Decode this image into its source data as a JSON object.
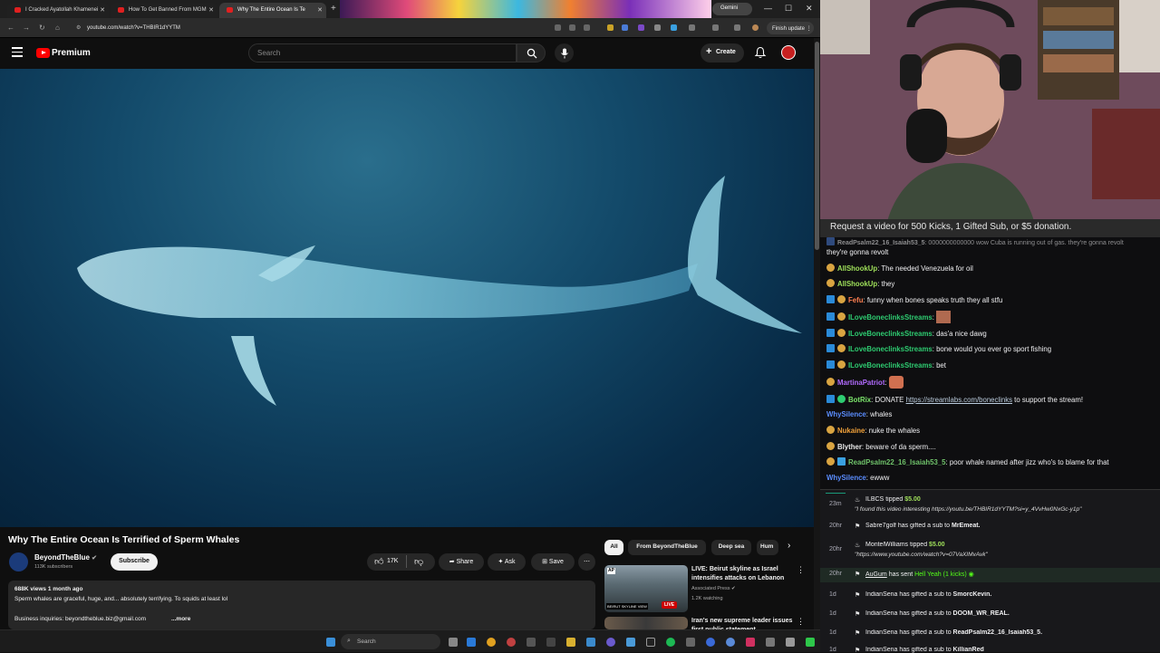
{
  "browser": {
    "tabs": [
      {
        "label": "I Cracked Ayatollah Khamenei",
        "active": false
      },
      {
        "label": "How To Get Banned From MGM",
        "active": false
      },
      {
        "label": "Why The Entire Ocean Is Te",
        "active": true
      }
    ],
    "url": "youtube.com/watch?v=THBIR1dYYTM",
    "gemini": "Gemini",
    "finish_update": "Finish update"
  },
  "youtube": {
    "logo": "Premium",
    "search_placeholder": "Search",
    "create_label": "Create",
    "video_title": "Why The Entire Ocean Is Terrified of Sperm Whales",
    "channel_name": "BeyondTheBlue",
    "subscribers": "113K subscribers",
    "subscribe_label": "Subscribe",
    "likes": "17K",
    "share_label": "Share",
    "ask_label": "Ask",
    "save_label": "Save",
    "views_line": "688K views  1 month ago",
    "desc_line1": "Sperm whales are graceful, huge, and... absolutely terrifying. To squids at least lol",
    "desc_line2": "Business inquiries: beyondtheblue.biz@gmail.com",
    "more_label": "...more",
    "chips": [
      "All",
      "From BeyondTheBlue",
      "Deep sea",
      "Hum"
    ],
    "related": [
      {
        "title": "LIVE: Beirut skyline as Israel intensifies attacks on Lebanon",
        "channel": "Associated Press",
        "meta": "1.2K watching",
        "badge": "LIVE",
        "thumb_caption": "BEIRUT SKYLINE VIEW"
      },
      {
        "title": "Iran's new supreme leader issues first public statement"
      }
    ]
  },
  "taskbar": {
    "search": "Search"
  },
  "stream": {
    "caption": "Request a video for 500 Kicks, 1 Gifted Sub, or $5 donation.",
    "chat": [
      {
        "user": "ReadPsalm22_16_Isaiah53_5",
        "text": "0000000000000 wow Cuba is running out of gas. they're gonna revolt",
        "color": "#6fc26a"
      },
      {
        "user": "AllShookUp",
        "text": "The needed Venezuela for oil",
        "color": "#9fe05a"
      },
      {
        "user": "AllShookUp",
        "text": "they",
        "color": "#9fe05a"
      },
      {
        "user": "Fefu",
        "text": "funny when bones speaks truth they all stfu",
        "color": "#ff7f50"
      },
      {
        "user": "ILoveBoneclinksStreams",
        "text": "",
        "color": "#2ecc71"
      },
      {
        "user": "ILoveBoneclinksStreams",
        "text": "das'a nice dawg",
        "color": "#2ecc71"
      },
      {
        "user": "ILoveBoneclinksStreams",
        "text": "bone would you ever go sport fishing",
        "color": "#2ecc71"
      },
      {
        "user": "ILoveBoneclinksStreams",
        "text": "bet",
        "color": "#2ecc71"
      },
      {
        "user": "MartinaPatriot",
        "text": "",
        "color": "#b26bff"
      },
      {
        "user": "BotRix",
        "text": "DONATE",
        "link": "https://streamlabs.com/boneclinks",
        "after": "to support the stream!",
        "color": "#7be36b"
      },
      {
        "user": "WhySilence",
        "text": "whales",
        "color": "#5b8dff"
      },
      {
        "user": "Nukaine",
        "text": "nuke the whales",
        "color": "#f2a23a"
      },
      {
        "user": "Blyther",
        "text": "beware of da sperm....",
        "color": "#e8e8e8"
      },
      {
        "user": "ReadPsalm22_16_Isaiah53_5",
        "text": "poor whale named after jizz who's to blame for that",
        "color": "#6fc26a"
      },
      {
        "user": "WhySilence",
        "text": "ewww",
        "color": "#5b8dff"
      }
    ],
    "events": [
      {
        "time": "23m",
        "user": "ILBCS",
        "action": "tipped",
        "amount": "$5.00",
        "quote": "\"I found this video interesting https://youtu.be/THBIR1dYYTM?si=y_4VvHw0NxGc-y1p\""
      },
      {
        "time": "20hr",
        "user": "Sabre7golf",
        "action": "has gifted a sub to",
        "target": "MrEmeat."
      },
      {
        "time": "20hr",
        "user": "MontelWilliams",
        "action": "tipped",
        "amount": "$5.00",
        "quote": "\"https://www.youtube.com/watch?v=07VaXIMvAvk\""
      },
      {
        "time": "20hr",
        "user": "AuGum",
        "action": "has sent",
        "target": "Hell Yeah (1 kicks)"
      },
      {
        "time": "1d",
        "user": "IndianSena",
        "action": "has gifted a sub to",
        "target": "SmorcKevin."
      },
      {
        "time": "1d",
        "user": "IndianSena",
        "action": "has gifted a sub to",
        "target": "DOOM_WR_REAL."
      },
      {
        "time": "1d",
        "user": "IndianSena",
        "action": "has gifted a sub to",
        "target": "ReadPsalm22_16_Isaiah53_5."
      },
      {
        "time": "1d",
        "user": "IndianSena",
        "action": "has gifted a sub to",
        "target": "KillianRed"
      }
    ]
  }
}
